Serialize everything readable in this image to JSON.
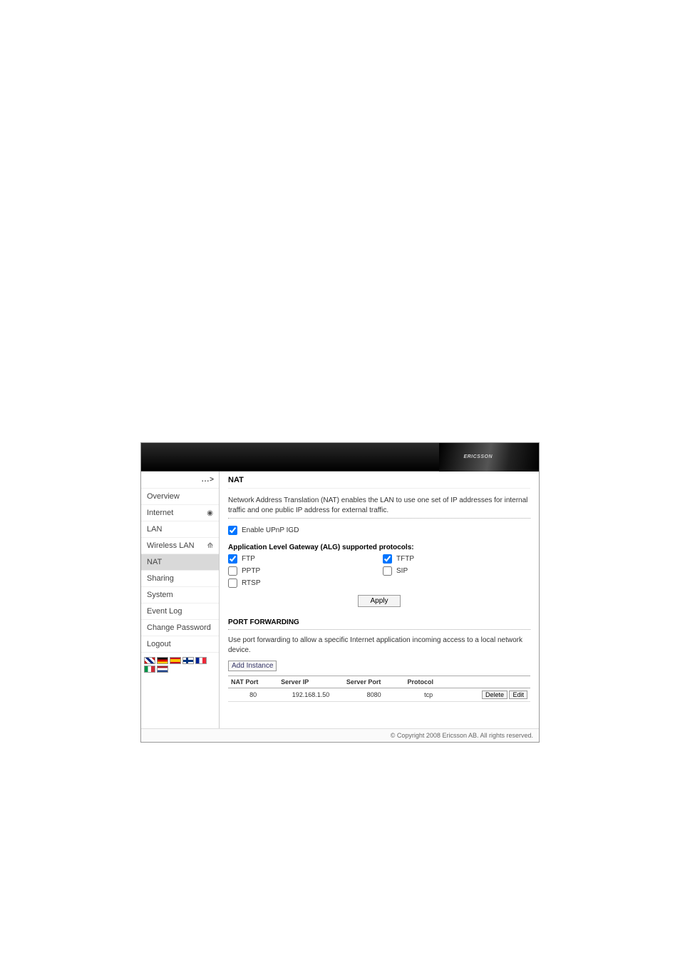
{
  "brand": "ERICSSON",
  "breadcrumb_icon": "...>",
  "sidebar": {
    "items": [
      {
        "label": "Overview",
        "active": false,
        "iconName": ""
      },
      {
        "label": "Internet",
        "active": false,
        "iconName": "globe-icon"
      },
      {
        "label": "LAN",
        "active": false,
        "iconName": ""
      },
      {
        "label": "Wireless LAN",
        "active": false,
        "iconName": "wifi-icon"
      },
      {
        "label": "NAT",
        "active": true,
        "iconName": ""
      },
      {
        "label": "Sharing",
        "active": false,
        "iconName": ""
      },
      {
        "label": "System",
        "active": false,
        "iconName": ""
      },
      {
        "label": "Event Log",
        "active": false,
        "iconName": ""
      },
      {
        "label": "Change Password",
        "active": false,
        "iconName": ""
      },
      {
        "label": "Logout",
        "active": false,
        "iconName": ""
      }
    ]
  },
  "page": {
    "title": "NAT",
    "description": "Network Address Translation (NAT) enables the LAN to use one set of IP addresses for internal traffic and one public IP address for external traffic.",
    "enable_upnp": {
      "label": "Enable UPnP IGD",
      "checked": true
    },
    "alg_heading": "Application Level Gateway (ALG) supported protocols:",
    "alg": [
      {
        "label": "FTP",
        "checked": true
      },
      {
        "label": "TFTP",
        "checked": true
      },
      {
        "label": "PPTP",
        "checked": false
      },
      {
        "label": "SIP",
        "checked": false
      },
      {
        "label": "RTSP",
        "checked": false
      }
    ],
    "apply_label": "Apply",
    "pf_heading": "PORT FORWARDING",
    "pf_desc": "Use port forwarding to allow a specific Internet application incoming access to a local network device.",
    "add_instance_label": "Add Instance",
    "pf_table": {
      "headers": {
        "nat_port": "NAT Port",
        "server_ip": "Server IP",
        "server_port": "Server Port",
        "protocol": "Protocol"
      },
      "rows": [
        {
          "nat_port": "80",
          "server_ip": "192.168.1.50",
          "server_port": "8080",
          "protocol": "tcp"
        }
      ],
      "delete_label": "Delete",
      "edit_label": "Edit"
    }
  },
  "footer": "© Copyright 2008 Ericsson AB. All rights reserved."
}
